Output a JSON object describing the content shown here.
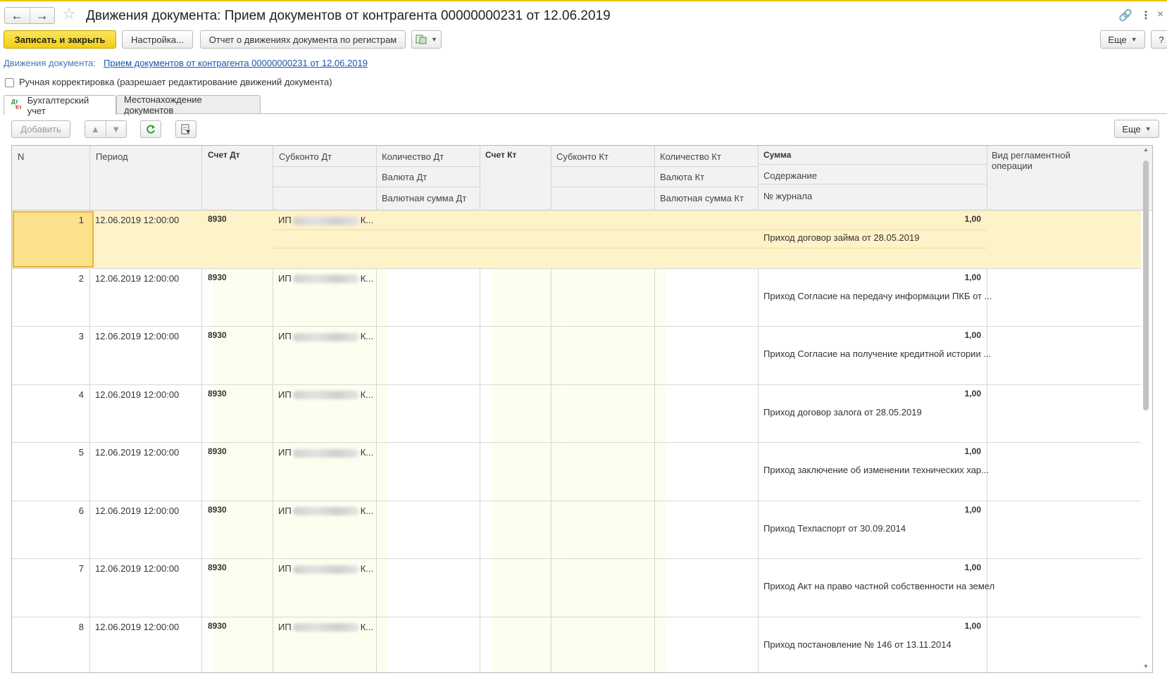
{
  "window": {
    "title": "Движения документа: Прием документов от контрагента 00000000231 от 12.06.2019",
    "back_icon": "←",
    "forward_icon": "→",
    "star_icon": "☆",
    "link_icon": "🔗",
    "menu_icon": "⋮",
    "close_icon": "×"
  },
  "toolbar": {
    "save_close": "Записать и закрыть",
    "settings": "Настройка...",
    "report": "Отчет о движениях документа по регистрам",
    "more": "Еще",
    "help": "?"
  },
  "movements": {
    "label": "Движения документа:",
    "link": "Прием документов от контрагента 00000000231 от 12.06.2019"
  },
  "manual": {
    "label": "Ручная корректировка (разрешает редактирование движений документа)"
  },
  "tabs": [
    {
      "label": "Бухгалтерский учет",
      "active": true
    },
    {
      "label": "Местонахождение документов",
      "active": false
    }
  ],
  "table_toolbar": {
    "add": "Добавить",
    "more": "Еще"
  },
  "columns": {
    "n": "N",
    "period": "Период",
    "account_dt": "Счет Дт",
    "subconto_dt": "Субконто Дт",
    "qty_dt": "Количество Дт",
    "currency_dt": "Валюта Дт",
    "cur_sum_dt": "Валютная сумма Дт",
    "account_kt": "Счет Кт",
    "subconto_kt": "Субконто Кт",
    "qty_kt": "Количество Кт",
    "currency_kt": "Валюта Кт",
    "cur_sum_kt": "Валютная сумма Кт",
    "sum": "Сумма",
    "content": "Содержание",
    "journal": "№ журнала",
    "op_type": "Вид регламентной операции"
  },
  "rows": [
    {
      "n": "1",
      "period": "12.06.2019 12:00:00",
      "account_dt": "8930",
      "sub_prefix": "ИП",
      "sub_suffix": "К...",
      "sum": "1,00",
      "content": "Приход договор займа от 28.05.2019"
    },
    {
      "n": "2",
      "period": "12.06.2019 12:00:00",
      "account_dt": "8930",
      "sub_prefix": "ИП",
      "sub_suffix": "К...",
      "sum": "1,00",
      "content": "Приход Согласие на передачу информации ПКБ от ..."
    },
    {
      "n": "3",
      "period": "12.06.2019 12:00:00",
      "account_dt": "8930",
      "sub_prefix": "ИП",
      "sub_suffix": "К...",
      "sum": "1,00",
      "content": "Приход Согласие на получение кредитной истории ..."
    },
    {
      "n": "4",
      "period": "12.06.2019 12:00:00",
      "account_dt": "8930",
      "sub_prefix": "ИП",
      "sub_suffix": "К...",
      "sum": "1,00",
      "content": "Приход договор залога от 28.05.2019"
    },
    {
      "n": "5",
      "period": "12.06.2019 12:00:00",
      "account_dt": "8930",
      "sub_prefix": "ИП",
      "sub_suffix": "К...",
      "sum": "1,00",
      "content": "Приход заключение об изменении технических хар..."
    },
    {
      "n": "6",
      "period": "12.06.2019 12:00:00",
      "account_dt": "8930",
      "sub_prefix": "ИП",
      "sub_suffix": "К...",
      "sum": "1,00",
      "content": "Приход Техпаспорт от 30.09.2014"
    },
    {
      "n": "7",
      "period": "12.06.2019 12:00:00",
      "account_dt": "8930",
      "sub_prefix": "ИП",
      "sub_suffix": "К...",
      "sum": "1,00",
      "content": "Приход Акт на право частной собственности на земел"
    },
    {
      "n": "8",
      "period": "12.06.2019 12:00:00",
      "account_dt": "8930",
      "sub_prefix": "ИП",
      "sub_suffix": "К...",
      "sum": "1,00",
      "content": "Приход постановление № 146 от 13.11.2014"
    }
  ]
}
